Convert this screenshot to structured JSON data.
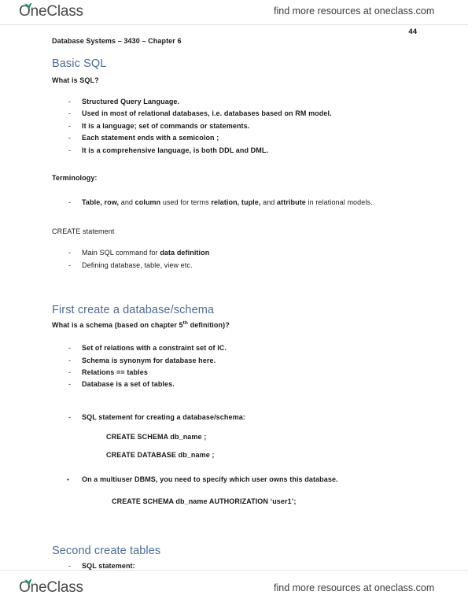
{
  "watermark": {
    "brand": "OneClass",
    "tagline": "find more resources at oneclass.com"
  },
  "page": {
    "number": "44",
    "doc_header": "Database Systems – 3430 – Chapter 6"
  },
  "sections": {
    "basic_sql": {
      "heading": "Basic SQL",
      "intro": "What is SQL?",
      "bullets": [
        "Structured Query Language.",
        "Used in most of relational databases, i.e. databases based on RM model.",
        "It is a language; set of commands or statements.",
        "Each statement ends with a semicolon ;",
        "It is a comprehensive language, is both DDL and DML."
      ]
    },
    "terminology": {
      "label": "Terminology:",
      "bullet_parts": [
        {
          "text": "Table, row, ",
          "bold": true
        },
        {
          "text": "and ",
          "bold": false
        },
        {
          "text": "column ",
          "bold": true
        },
        {
          "text": "used for terms ",
          "bold": false
        },
        {
          "text": "relation, tuple, ",
          "bold": true
        },
        {
          "text": "and ",
          "bold": false
        },
        {
          "text": "attribute ",
          "bold": true
        },
        {
          "text": "in relational models.",
          "bold": false
        }
      ]
    },
    "create_statement": {
      "label": "CREATE statement",
      "bullets": [
        {
          "prefix": "Main SQL command for ",
          "strong": "data definition",
          "suffix": ""
        },
        {
          "prefix": "Defining database, table, view etc.",
          "strong": "",
          "suffix": ""
        }
      ]
    },
    "first_create": {
      "heading": "First create a database/schema",
      "question_pre": "What is a schema (based on chapter 5",
      "question_sup": "th",
      "question_post": " definition)?",
      "bullets": [
        "Set of relations with a constraint set of IC.",
        "Schema is synonym for database here.",
        "Relations == tables",
        "Database is a set of tables."
      ],
      "sql_bullet": "SQL statement for creating a database/schema:",
      "sql_lines": [
        "CREATE SCHEMA db_name ;",
        "CREATE DATABASE db_name ;"
      ],
      "multiuser_bullet": "On a multiuser DBMS, you need to specify which user owns this database.",
      "multiuser_code": "CREATE SCHEMA db_name AUTHORIZATION ‘user1’;"
    },
    "second_create": {
      "heading": "Second create tables",
      "bullet": "SQL statement:"
    }
  },
  "markers": {
    "dash": "-",
    "round": "•"
  },
  "colors": {
    "heading_blue": "#4e6b91",
    "leaf_green": "#2f8f62",
    "rule": "#e3e3e3",
    "text": "#1a1a1a"
  }
}
